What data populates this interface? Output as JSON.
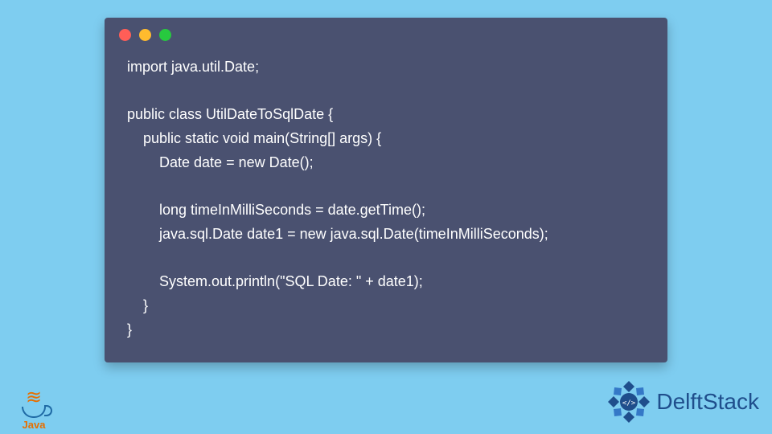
{
  "code": {
    "lines": [
      "import java.util.Date;",
      "",
      "public class UtilDateToSqlDate {",
      "    public static void main(String[] args) {",
      "        Date date = new Date();",
      "",
      "        long timeInMilliSeconds = date.getTime();",
      "        java.sql.Date date1 = new java.sql.Date(timeInMilliSeconds);",
      "",
      "        System.out.println(\"SQL Date: \" + date1);",
      "    }",
      "}"
    ]
  },
  "window": {
    "dots": [
      "red",
      "yellow",
      "green"
    ]
  },
  "logos": {
    "java_label": "Java",
    "delft_label": "DelftStack"
  },
  "colors": {
    "bg": "#7ecdf0",
    "window_bg": "#4a5170",
    "code_text": "#ffffff",
    "java_orange": "#e76f00",
    "java_blue": "#1f6aa5",
    "delft_blue": "#1f4e8c"
  }
}
